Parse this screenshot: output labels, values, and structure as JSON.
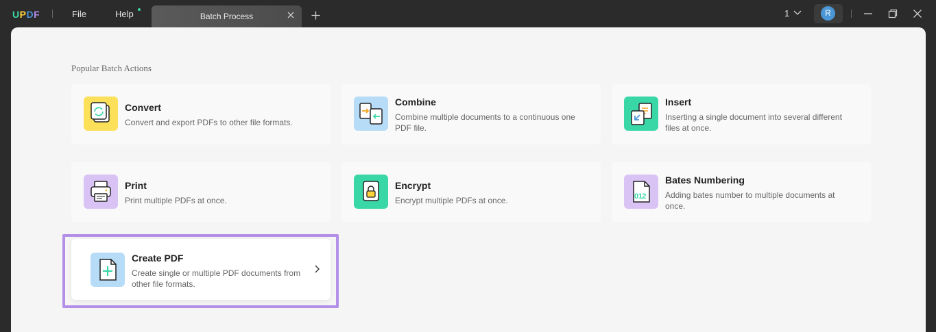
{
  "app": {
    "logo": [
      "U",
      "P",
      "D",
      "F"
    ],
    "logo_colors": [
      "#3ad7a6",
      "#ffd43b",
      "#4a96d6",
      "#b48fe8"
    ]
  },
  "menu": {
    "file": "File",
    "help": "Help"
  },
  "tab": {
    "label": "Batch Process"
  },
  "header": {
    "page_count": "1",
    "avatar_initial": "R"
  },
  "section": {
    "title": "Popular Batch Actions"
  },
  "cards": {
    "convert": {
      "title": "Convert",
      "desc": "Convert and export PDFs to other file formats.",
      "icon": "convert-icon",
      "color": "#fde05a"
    },
    "combine": {
      "title": "Combine",
      "desc": "Combine multiple documents to a continuous one PDF file.",
      "icon": "combine-icon",
      "color": "#b6dcf7"
    },
    "insert": {
      "title": "Insert",
      "desc": "Inserting a single document into several different files at once.",
      "icon": "insert-icon",
      "color": "#3ad7a6"
    },
    "print": {
      "title": "Print",
      "desc": "Print multiple PDFs at once.",
      "icon": "printer-icon",
      "color": "#d9c3f5"
    },
    "encrypt": {
      "title": "Encrypt",
      "desc": "Encrypt multiple PDFs at once.",
      "icon": "lock-icon",
      "color": "#3ad7a6"
    },
    "bates": {
      "title": "Bates Numbering",
      "desc": "Adding bates number to multiple documents at once.",
      "icon": "bates-number-icon",
      "color": "#d9c3f5"
    },
    "create": {
      "title": "Create PDF",
      "desc": "Create single or multiple PDF documents from other file formats.",
      "icon": "create-pdf-icon",
      "color": "#b6dcf7"
    }
  },
  "bates_icon_text": "012"
}
